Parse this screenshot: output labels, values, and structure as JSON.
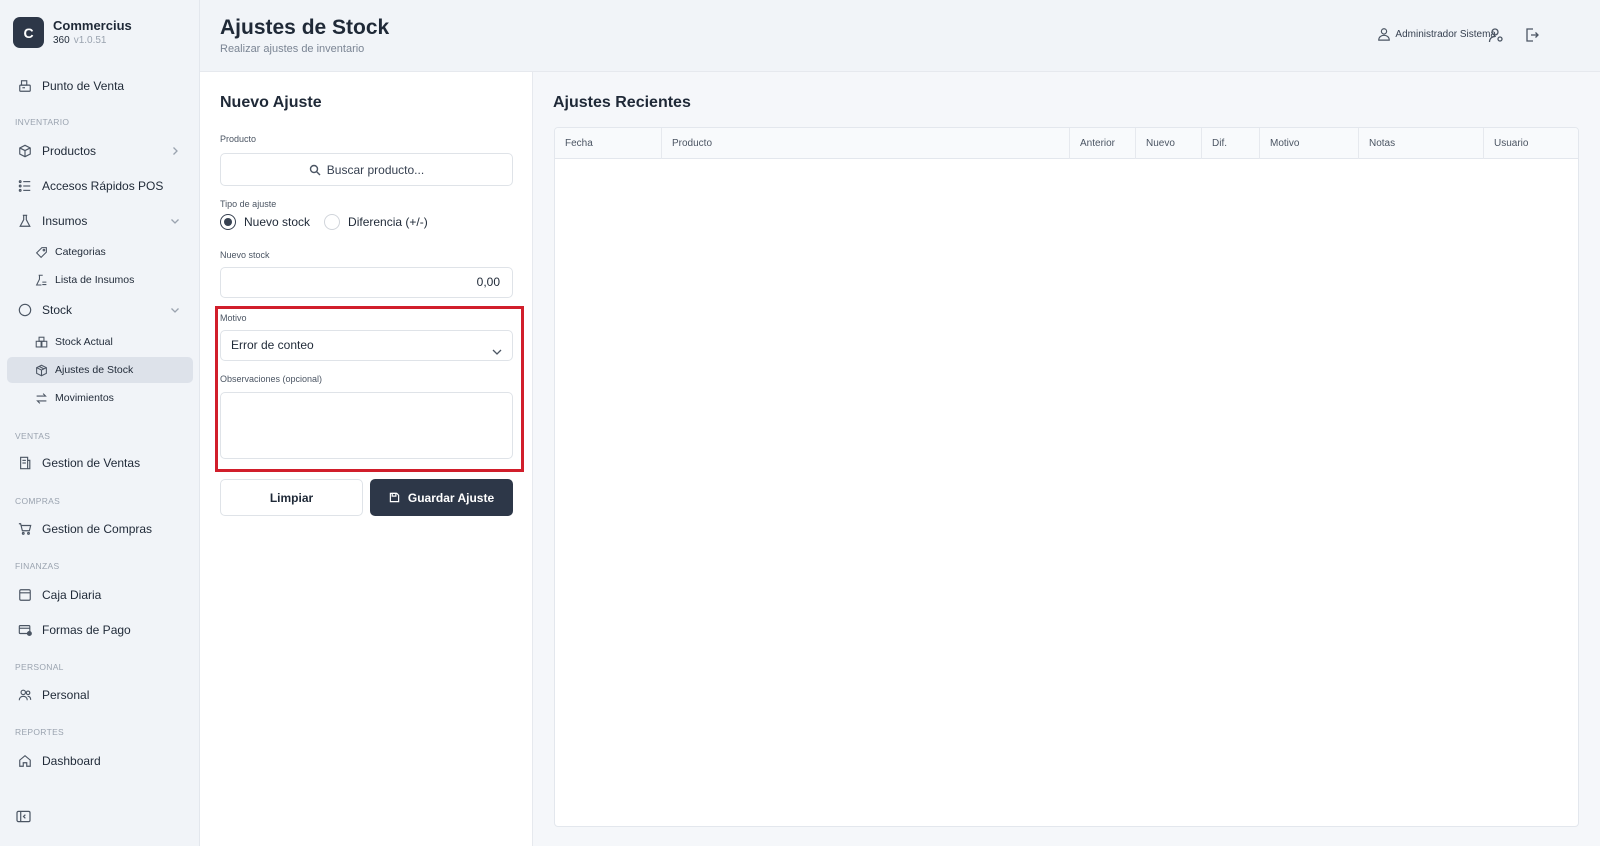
{
  "brand": {
    "logo_letter": "C",
    "name": "Commercius",
    "sub": "360",
    "version": "v1.0.51"
  },
  "sidebar": {
    "top_item": "Punto de Venta",
    "sections": {
      "inventario": "INVENTARIO",
      "ventas": "VENTAS",
      "compras": "COMPRAS",
      "finanzas": "FINANZAS",
      "personal": "PERSONAL",
      "reportes": "REPORTES"
    },
    "items": {
      "productos": "Productos",
      "accesos": "Accesos Rápidos POS",
      "insumos": "Insumos",
      "categorias": "Categorias",
      "lista_insumos": "Lista de Insumos",
      "stock": "Stock",
      "stock_actual": "Stock Actual",
      "ajustes_stock": "Ajustes de Stock",
      "movimientos": "Movimientos",
      "gestion_ventas": "Gestion de Ventas",
      "gestion_compras": "Gestion de Compras",
      "caja_diaria": "Caja Diaria",
      "formas_pago": "Formas de Pago",
      "personal": "Personal",
      "dashboard": "Dashboard"
    }
  },
  "header": {
    "title": "Ajustes de Stock",
    "subtitle": "Realizar ajustes de inventario",
    "user": "Administrador Sistema"
  },
  "form": {
    "title": "Nuevo Ajuste",
    "product_label": "Producto",
    "search_placeholder": "Buscar producto...",
    "type_label": "Tipo de ajuste",
    "type_options": [
      "Nuevo stock",
      "Diferencia (+/-)"
    ],
    "type_selected": "Nuevo stock",
    "new_stock_label": "Nuevo stock",
    "new_stock_value": "0,00",
    "reason_label": "Motivo",
    "reason_value": "Error de conteo",
    "notes_label": "Observaciones (opcional)",
    "notes_value": "",
    "clear_button": "Limpiar",
    "save_button": "Guardar Ajuste"
  },
  "recent": {
    "title": "Ajustes Recientes",
    "columns": [
      "Fecha",
      "Producto",
      "Anterior",
      "Nuevo",
      "Dif.",
      "Motivo",
      "Notas",
      "Usuario"
    ],
    "rows": []
  }
}
